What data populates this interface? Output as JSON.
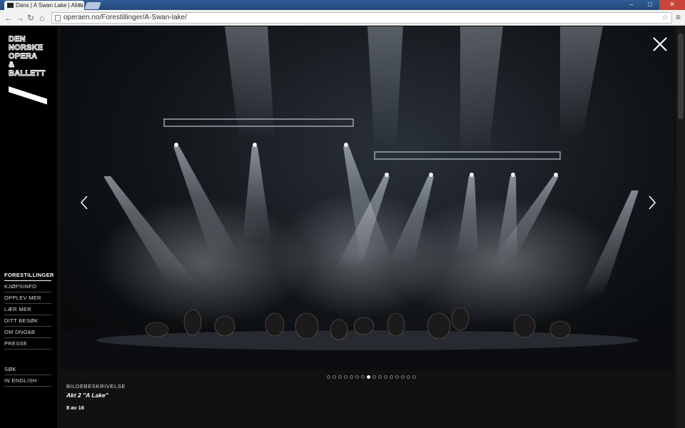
{
  "browser": {
    "tab_title": "Dans | A Swan Lake | Alisa",
    "tab_close": "×",
    "url": "operaen.no/Forestillinger/A-Swan-lake/",
    "window_buttons": [
      "–",
      "□",
      "✕"
    ],
    "back": "←",
    "forward": "→",
    "reload": "↻",
    "home": "⌂",
    "star": "☆",
    "menu": "≡"
  },
  "logo": {
    "lines": [
      "DEN",
      "NORSKE",
      "OPERA",
      "&",
      "BALLETT"
    ]
  },
  "nav": {
    "items": [
      {
        "label": "FORESTILLINGER",
        "active": true
      },
      {
        "label": "KJØPSINFO"
      },
      {
        "label": "OPPLEV MER"
      },
      {
        "label": "LÆR MER"
      },
      {
        "label": "DITT BESØK"
      },
      {
        "label": "OM DNO&B"
      },
      {
        "label": "PRESSE"
      }
    ],
    "secondary": [
      {
        "label": "SØK"
      },
      {
        "label": "IN ENGLISH"
      }
    ]
  },
  "gallery": {
    "current": 8,
    "total": 16,
    "caption_label": "BILDEBESKRIVELSE",
    "caption_title": "Akt 2 \"A Lake\"",
    "counter": "8 av 16"
  },
  "colors": {
    "accent": "#ffffff",
    "background": "#000000"
  }
}
